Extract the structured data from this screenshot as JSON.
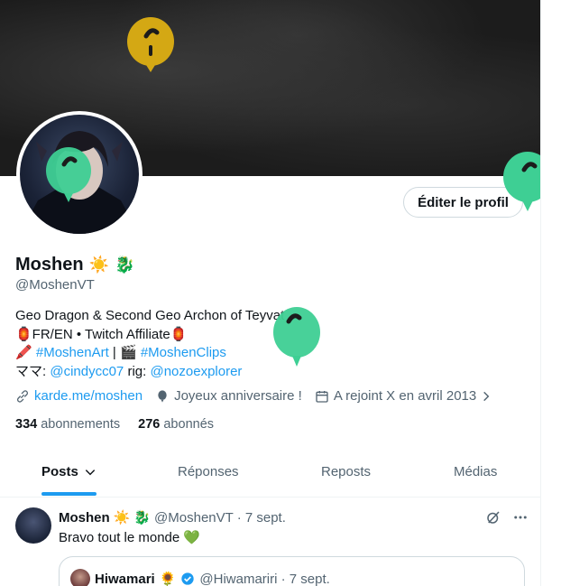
{
  "profile": {
    "name": "Moshen",
    "handle": "@MoshenVT",
    "edit_button": "Éditer le profil",
    "bio": {
      "line1": "Geo Dragon & Second Geo Archon of Teyvat",
      "line2": "🏮FR/EN • Twitch Affiliate🏮",
      "line3_emoji1": "🖍️",
      "line3_tag1": "#MoshenArt",
      "line3_sep": " | ",
      "line3_emoji2": "🎬",
      "line3_tag2": "#MoshenClips",
      "line4_prefix": "ママ: ",
      "line4_mama": "@cindycc07",
      "line4_rig_label": " rig: ",
      "line4_rig": "@nozoexplorer"
    },
    "meta": {
      "link": "karde.me/moshen",
      "birthday": "Joyeux anniversaire !",
      "joined": "A rejoint X en avril 2013"
    },
    "stats": {
      "following_count": "334",
      "following_label": " abonnements",
      "followers_count": "276",
      "followers_label": " abonnés"
    },
    "name_emojis": [
      "☀️",
      "🐉"
    ]
  },
  "tabs": [
    {
      "label": "Posts",
      "active": true
    },
    {
      "label": "Réponses",
      "active": false
    },
    {
      "label": "Reposts",
      "active": false
    },
    {
      "label": "Médias",
      "active": false
    }
  ],
  "tweet": {
    "author": "Moshen",
    "handle_date": "@MoshenVT · 7 sept.",
    "text": "Bravo tout le monde 💚",
    "quote": {
      "author": "Hiwamari",
      "emoji": "🌻",
      "handle_date": "@Hiwamariri · 7 sept."
    }
  },
  "colors": {
    "accent": "#1d9bf0",
    "balloon_yellow": "#d4a814",
    "balloon_green": "#3ecf94",
    "text_secondary": "#536471"
  }
}
